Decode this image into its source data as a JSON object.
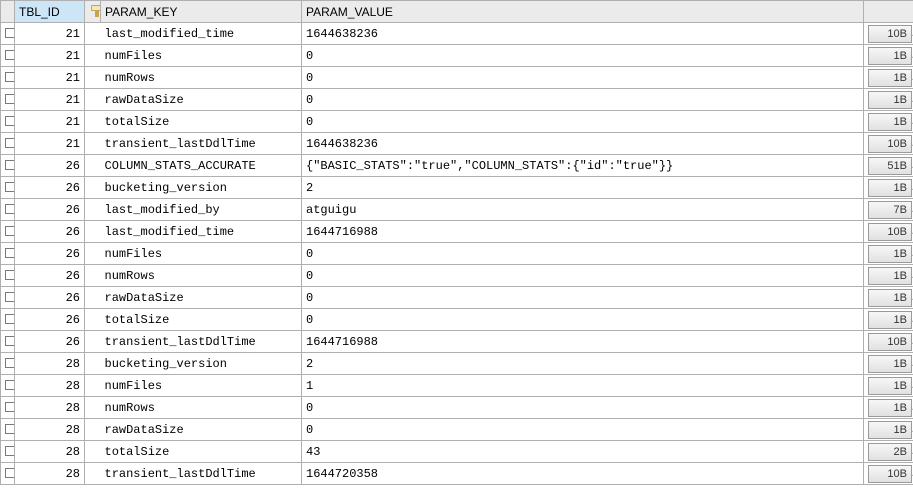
{
  "columns": {
    "tbl_id": "TBL_ID",
    "param_key": "PARAM_KEY",
    "param_value": "PARAM_VALUE"
  },
  "rows": [
    {
      "tbl_id": "21",
      "param_key": "last_modified_time",
      "param_value": "1644638236",
      "size": "10B"
    },
    {
      "tbl_id": "21",
      "param_key": "numFiles",
      "param_value": "0",
      "size": "1B"
    },
    {
      "tbl_id": "21",
      "param_key": "numRows",
      "param_value": "0",
      "size": "1B"
    },
    {
      "tbl_id": "21",
      "param_key": "rawDataSize",
      "param_value": "0",
      "size": "1B"
    },
    {
      "tbl_id": "21",
      "param_key": "totalSize",
      "param_value": "0",
      "size": "1B"
    },
    {
      "tbl_id": "21",
      "param_key": "transient_lastDdlTime",
      "param_value": "1644638236",
      "size": "10B"
    },
    {
      "tbl_id": "26",
      "param_key": "COLUMN_STATS_ACCURATE",
      "param_value": "{\"BASIC_STATS\":\"true\",\"COLUMN_STATS\":{\"id\":\"true\"}}",
      "size": "51B"
    },
    {
      "tbl_id": "26",
      "param_key": "bucketing_version",
      "param_value": "2",
      "size": "1B"
    },
    {
      "tbl_id": "26",
      "param_key": "last_modified_by",
      "param_value": "atguigu",
      "size": "7B"
    },
    {
      "tbl_id": "26",
      "param_key": "last_modified_time",
      "param_value": "1644716988",
      "size": "10B"
    },
    {
      "tbl_id": "26",
      "param_key": "numFiles",
      "param_value": "0",
      "size": "1B"
    },
    {
      "tbl_id": "26",
      "param_key": "numRows",
      "param_value": "0",
      "size": "1B"
    },
    {
      "tbl_id": "26",
      "param_key": "rawDataSize",
      "param_value": "0",
      "size": "1B"
    },
    {
      "tbl_id": "26",
      "param_key": "totalSize",
      "param_value": "0",
      "size": "1B"
    },
    {
      "tbl_id": "26",
      "param_key": "transient_lastDdlTime",
      "param_value": "1644716988",
      "size": "10B"
    },
    {
      "tbl_id": "28",
      "param_key": "bucketing_version",
      "param_value": "2",
      "size": "1B"
    },
    {
      "tbl_id": "28",
      "param_key": "numFiles",
      "param_value": "1",
      "size": "1B"
    },
    {
      "tbl_id": "28",
      "param_key": "numRows",
      "param_value": "0",
      "size": "1B"
    },
    {
      "tbl_id": "28",
      "param_key": "rawDataSize",
      "param_value": "0",
      "size": "1B"
    },
    {
      "tbl_id": "28",
      "param_key": "totalSize",
      "param_value": "43",
      "size": "2B"
    },
    {
      "tbl_id": "28",
      "param_key": "transient_lastDdlTime",
      "param_value": "1644720358",
      "size": "10B"
    }
  ]
}
